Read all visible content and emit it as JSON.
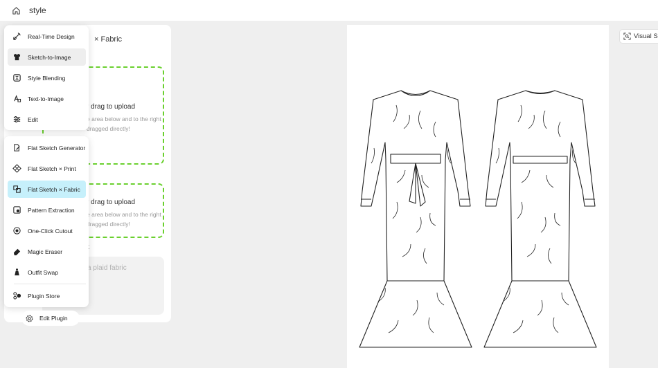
{
  "topbar": {
    "title": "style"
  },
  "panel": {
    "title": "× Fabric",
    "upload1": {
      "main": "r drag to upload",
      "sub1": "e area below and to the right",
      "sub2": "dragged directly!"
    },
    "upload2": {
      "main": "r drag to upload",
      "sub1": "e area below and to the right",
      "sub2": "dragged directly!"
    },
    "prompt_label": "t",
    "prompt_placeholder": "a plaid fabric"
  },
  "menu": {
    "group1": [
      {
        "label": "Real-Time Design",
        "icon": "pen-ruler-icon"
      },
      {
        "label": "Sketch-to-Image",
        "icon": "shirt-icon"
      },
      {
        "label": "Style Blending",
        "icon": "blend-icon"
      },
      {
        "label": "Text-to-Image",
        "icon": "text-image-icon"
      },
      {
        "label": "Edit",
        "icon": "sliders-icon"
      }
    ],
    "group2": [
      {
        "label": "Flat Sketch Generator",
        "icon": "sketch-pen-icon"
      },
      {
        "label": "Flat Sketch × Print",
        "icon": "pattern-grid-icon"
      },
      {
        "label": "Flat Sketch × Fabric",
        "icon": "fabric-swap-icon"
      },
      {
        "label": "Pattern Extraction",
        "icon": "extract-icon"
      },
      {
        "label": "One-Click Cutout",
        "icon": "cutout-icon"
      },
      {
        "label": "Magic Eraser",
        "icon": "eraser-icon"
      },
      {
        "label": "Outfit Swap",
        "icon": "outfit-icon"
      },
      {
        "label": "Plugin Store",
        "icon": "plugin-store-icon"
      }
    ],
    "edit_plugin": "Edit Plugin"
  },
  "right_tab": {
    "label": "Visual Se"
  },
  "colors": {
    "accent_dashed": "#6ad02e",
    "active_item": "#c6f0fb"
  }
}
